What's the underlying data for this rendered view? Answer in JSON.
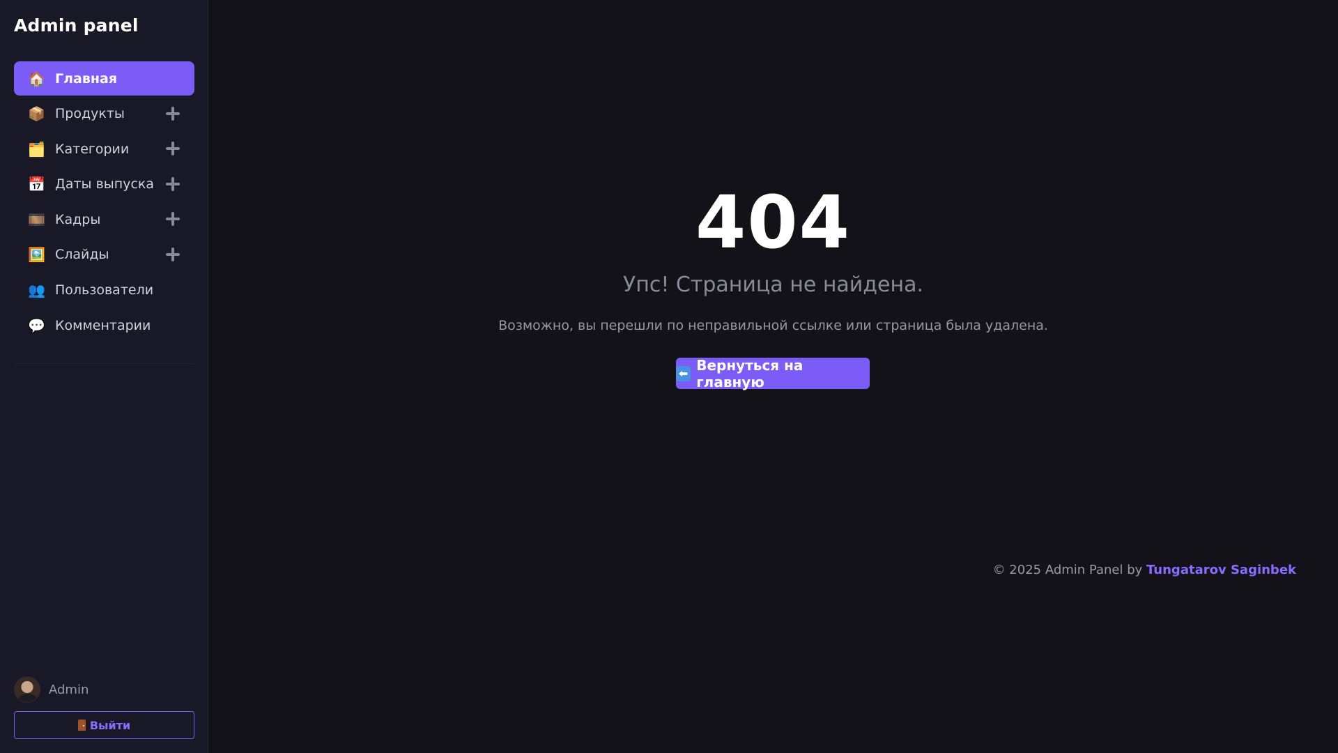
{
  "sidebar": {
    "brand": "Admin panel",
    "items": [
      {
        "label": "Главная",
        "icon": "🏠",
        "active": true,
        "plus": false
      },
      {
        "label": "Продукты",
        "icon": "📦",
        "active": false,
        "plus": true
      },
      {
        "label": "Категории",
        "icon": "🗂️",
        "active": false,
        "plus": true
      },
      {
        "label": "Даты выпуска",
        "icon": "📅",
        "active": false,
        "plus": true
      },
      {
        "label": "Кадры",
        "icon": "🎞️",
        "active": false,
        "plus": true
      },
      {
        "label": "Слайды",
        "icon": "🖼️",
        "active": false,
        "plus": true
      },
      {
        "label": "Пользователи",
        "icon": "👥",
        "active": false,
        "plus": false
      },
      {
        "label": "Комментарии",
        "icon": "💬",
        "active": false,
        "plus": false
      }
    ],
    "user": {
      "name": "Admin"
    },
    "logout_label": "Выйти"
  },
  "main": {
    "code": "404",
    "title": "Упс! Страница не найдена.",
    "description": "Возможно, вы перешли по неправильной ссылке или страница была удалена.",
    "home_button": "Вернуться на главную",
    "home_button_icon": "⬅"
  },
  "footer": {
    "prefix": "© 2025 Admin Panel by ",
    "author": "Tungatarov Saginbek"
  },
  "colors": {
    "accent": "#7c5cf7",
    "background": "#121218",
    "sidebar": "#181826"
  }
}
